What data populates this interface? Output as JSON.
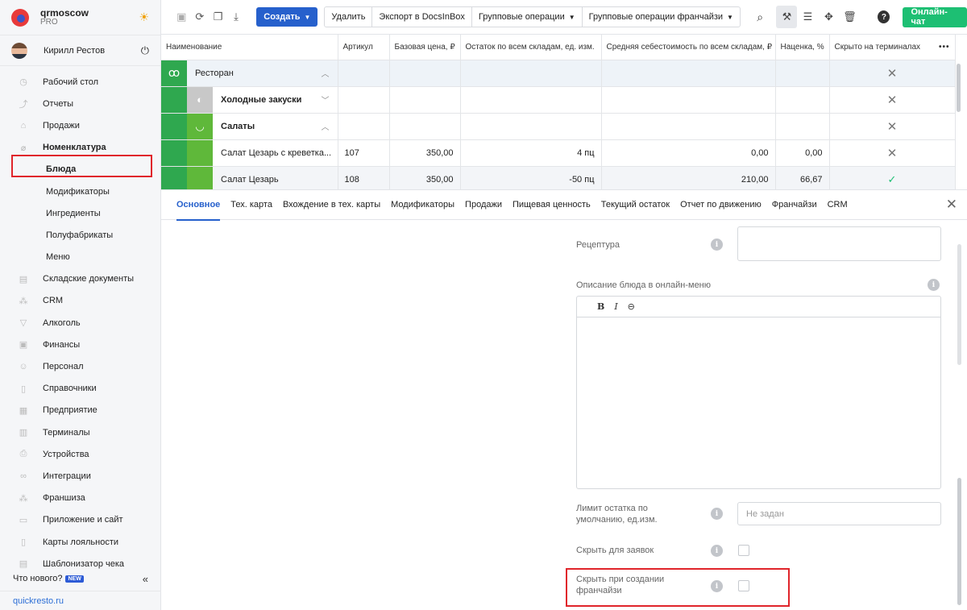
{
  "brand": {
    "name": "qrmoscow",
    "tier": "PRO"
  },
  "user": {
    "name": "Кирилл Рестов"
  },
  "nav": [
    {
      "label": "Рабочий стол",
      "icon": "◷",
      "name": "dashboard"
    },
    {
      "label": "Отчеты",
      "icon": "⤴",
      "name": "reports"
    },
    {
      "label": "Продажи",
      "icon": "⌂",
      "name": "sales"
    },
    {
      "label": "Номенклатура",
      "icon": "⌀",
      "name": "nomenclature"
    },
    {
      "label": "Блюда",
      "name": "dishes"
    },
    {
      "label": "Модификаторы",
      "name": "modifiers"
    },
    {
      "label": "Ингредиенты",
      "name": "ingredients"
    },
    {
      "label": "Полуфабрикаты",
      "name": "semi-finished"
    },
    {
      "label": "Меню",
      "name": "menu"
    },
    {
      "label": "Складские документы",
      "icon": "▤",
      "name": "warehouse-docs"
    },
    {
      "label": "CRM",
      "icon": "⁂",
      "name": "crm"
    },
    {
      "label": "Алкоголь",
      "icon": "▽",
      "name": "alcohol"
    },
    {
      "label": "Финансы",
      "icon": "▣",
      "name": "finance"
    },
    {
      "label": "Персонал",
      "icon": "☺",
      "name": "staff"
    },
    {
      "label": "Справочники",
      "icon": "▯",
      "name": "references"
    },
    {
      "label": "Предприятие",
      "icon": "▦",
      "name": "enterprise"
    },
    {
      "label": "Терминалы",
      "icon": "▥",
      "name": "terminals"
    },
    {
      "label": "Устройства",
      "icon": "⎙",
      "name": "devices"
    },
    {
      "label": "Интеграции",
      "icon": "∞",
      "name": "integrations"
    },
    {
      "label": "Франшиза",
      "icon": "⁂",
      "name": "franchise"
    },
    {
      "label": "Приложение и сайт",
      "icon": "▭",
      "name": "app-site"
    },
    {
      "label": "Карты лояльности",
      "icon": "▯",
      "name": "loyalty-cards"
    },
    {
      "label": "Шаблонизатор чека",
      "icon": "▤",
      "name": "receipt-templates"
    }
  ],
  "whatsnew": {
    "label": "Что нового?",
    "badge": "NEW"
  },
  "footer": {
    "link": "quickresto.ru"
  },
  "toolbar": {
    "create_label": "Создать",
    "delete_label": "Удалить",
    "export_label": "Экспорт в DocsInBox",
    "group_ops_label": "Групповые операции",
    "group_ops_franchise_label": "Групповые операции франчайзи",
    "chat_label": "Онлайн-чат"
  },
  "table": {
    "columns": [
      "Наименование",
      "Артикул",
      "Базовая цена, ₽",
      "Остаток по всем складам, ед. изм.",
      "Средняя себестоимость по всем складам, ₽",
      "Наценка, %",
      "Скрыто на терминалах"
    ],
    "more_label": "•••",
    "rows": [
      {
        "name": "Ресторан",
        "article": "",
        "price": "",
        "stock": "",
        "cost": "",
        "markup": "",
        "hidden": "✕"
      },
      {
        "name": "Холодные закуски",
        "article": "",
        "price": "",
        "stock": "",
        "cost": "",
        "markup": "",
        "hidden": "✕"
      },
      {
        "name": "Салаты",
        "article": "",
        "price": "",
        "stock": "",
        "cost": "",
        "markup": "",
        "hidden": "✕"
      },
      {
        "name": "Салат Цезарь с креветка...",
        "article": "107",
        "price": "350,00",
        "stock": "4 пц",
        "cost": "0,00",
        "markup": "0,00",
        "hidden": "✕"
      },
      {
        "name": "Салат Цезарь",
        "article": "108",
        "price": "350,00",
        "stock": "-50 пц",
        "cost": "210,00",
        "markup": "66,67",
        "hidden": "✓"
      }
    ]
  },
  "tabs": [
    "Основное",
    "Тех. карта",
    "Вхождение в тех. карты",
    "Модификаторы",
    "Продажи",
    "Пищевая ценность",
    "Текущий остаток",
    "Отчет по движению",
    "Франчайзи",
    "CRM"
  ],
  "form": {
    "recipe_label": "Рецептура",
    "description_label": "Описание блюда в онлайн-меню",
    "editor": {
      "bold": "B",
      "italic": "I",
      "link": "⊖"
    },
    "limit_label": "Лимит остатка по умолчанию, ед.изм.",
    "limit_placeholder": "Не задан",
    "hide_requests_label": "Скрыть для заявок",
    "hide_franchise_label": "Скрыть при создании франчайзи",
    "info": "i"
  }
}
